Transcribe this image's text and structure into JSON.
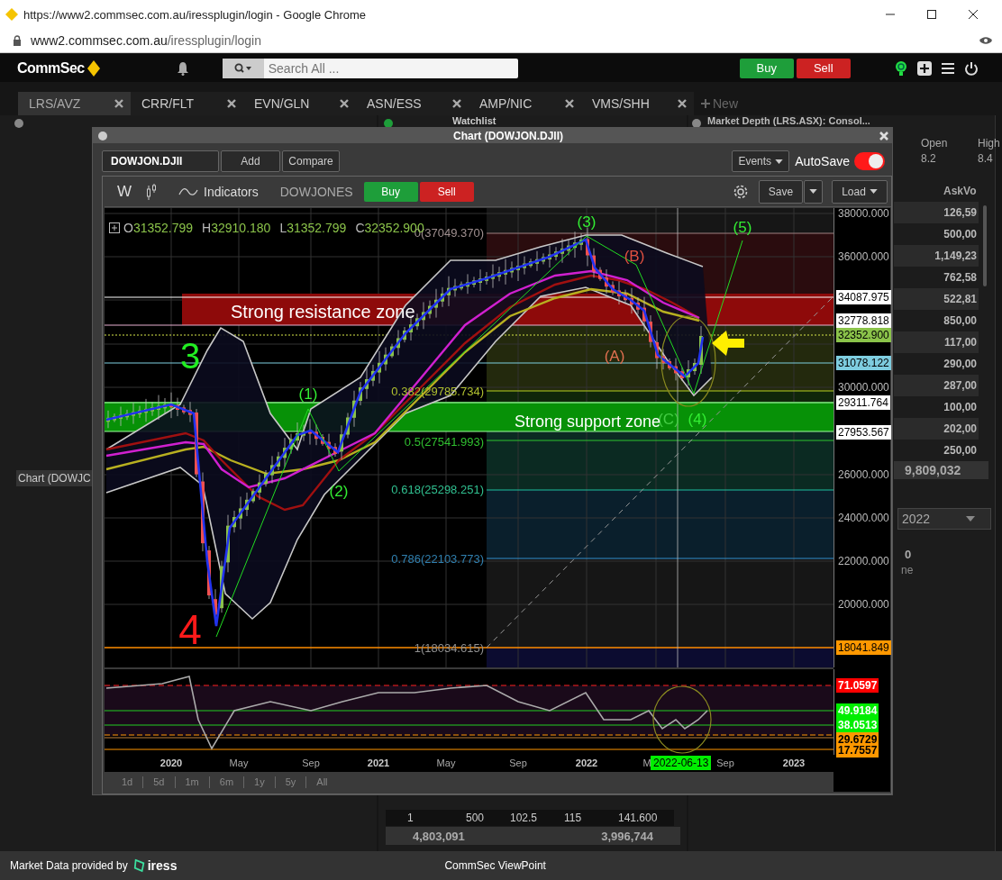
{
  "browser": {
    "title": "https://www2.commsec.com.au/iressplugin/login - Google Chrome",
    "address_host": "www2.commsec.com.au",
    "address_path": "/iressplugin/login"
  },
  "app_header": {
    "logo": "CommSec",
    "search": {
      "placeholder": "Search All ..."
    },
    "buttons": [
      {
        "label": "Buy",
        "kind": "buy"
      },
      {
        "label": "Sell",
        "kind": "sell"
      }
    ]
  },
  "tabs": [
    {
      "label": "LRS/AVZ",
      "selected": true
    },
    {
      "label": "CRR/FLT",
      "selected": false
    },
    {
      "label": "EVN/GLN",
      "selected": false
    },
    {
      "label": "ASN/ESS",
      "selected": false
    },
    {
      "label": "AMP/NIC",
      "selected": false
    },
    {
      "label": "VMS/SHH",
      "selected": false
    }
  ],
  "new_tab": "New",
  "left_panel": {
    "label": "Chart (DOWJC"
  },
  "watchlist": {
    "title": "Watchlist",
    "row": [
      "1",
      "500",
      "102.5",
      "115",
      "141.600"
    ],
    "totals": [
      "4,803,091",
      "3,996,744"
    ]
  },
  "market_depth": {
    "title": "Market Depth (LRS.ASX): Consol...",
    "stats": [
      {
        "label": "Open",
        "value": "8.2"
      },
      {
        "label": "High",
        "value": "8.4"
      }
    ],
    "column_header": "AskVo",
    "rows": [
      "126,59",
      "500,00",
      "1,149,23",
      "762,58",
      "522,81",
      "850,00",
      "117,00",
      "290,00",
      "287,00",
      "100,00",
      "202,00",
      "250,00"
    ],
    "total": "9,809,032",
    "date_field": "2022",
    "count": "0",
    "label_fragment": "ne"
  },
  "footer": {
    "provider_text": "Market Data provided by",
    "provider_logo": "iress",
    "title": "CommSec ViewPoint"
  },
  "chart_window": {
    "title": "Chart (DOWJON.DJII)",
    "symbol": "DOWJON.DJII",
    "buttons": [
      "Add",
      "Compare"
    ],
    "events": "Events",
    "autosave": {
      "label": "AutoSave",
      "on": true
    },
    "toolbar": {
      "period": "W",
      "indicators": "Indicators",
      "instrument": "DOWJONES",
      "buy": "Buy",
      "sell": "Sell",
      "save": "Save",
      "load": "Load"
    },
    "ohlc": [
      {
        "label": "O",
        "value": "31352.799"
      },
      {
        "label": "H",
        "value": "32910.180"
      },
      {
        "label": "L",
        "value": "31352.799"
      },
      {
        "label": "C",
        "value": "32352.900"
      }
    ],
    "zones": [
      "Strong resistance zone",
      "Strong support zone"
    ],
    "annotations": [
      {
        "text": "(3)",
        "color": "#33ee33"
      },
      {
        "text": "(5)",
        "color": "#33ee33"
      },
      {
        "text": "(B)",
        "color": "#e05040"
      },
      {
        "text": "(A)",
        "color": "#e07050"
      },
      {
        "text": "(1)",
        "color": "#33ee33"
      },
      {
        "text": "(2)",
        "color": "#33ee33"
      },
      {
        "text": "(C)",
        "color": "#44cc44"
      },
      {
        "text": "(4)",
        "color": "#33ee33"
      },
      {
        "text": "3",
        "color": "#22ee22"
      },
      {
        "text": "4",
        "color": "#ff1a1a"
      }
    ],
    "fib_levels": [
      {
        "text": "0(37049.370)",
        "color": "#a09090"
      },
      {
        "text": "0.382(29785.734)",
        "color": "#b0c030"
      },
      {
        "text": "0.5(27541.993)",
        "color": "#30c030"
      },
      {
        "text": "0.618(25298.251)",
        "color": "#30c090"
      },
      {
        "text": "0.786(22103.773)",
        "color": "#3080b0"
      },
      {
        "text": "1(18034.615)",
        "color": "#909090"
      }
    ],
    "price_axis": [
      {
        "label": "38000.000",
        "kind": "tick"
      },
      {
        "label": "36000.000",
        "kind": "tick"
      },
      {
        "label": "34087.975",
        "kind": "tag",
        "color": "#ffffff"
      },
      {
        "label": "32778.818",
        "kind": "tag",
        "color": "#ffffff"
      },
      {
        "label": "32352.900",
        "kind": "tag",
        "color": "#8bc34a"
      },
      {
        "label": "31078.122",
        "kind": "tag",
        "color": "#7ecde0"
      },
      {
        "label": "30000.000",
        "kind": "tick"
      },
      {
        "label": "29311.764",
        "kind": "tag",
        "color": "#ffffff"
      },
      {
        "label": "27953.567",
        "kind": "tag",
        "color": "#ffffff"
      },
      {
        "label": "26000.000",
        "kind": "tick"
      },
      {
        "label": "24000.000",
        "kind": "tick"
      },
      {
        "label": "22000.000",
        "kind": "tick"
      },
      {
        "label": "20000.000",
        "kind": "tick"
      },
      {
        "label": "18041.849",
        "kind": "tag",
        "color": "#ff9800"
      }
    ],
    "rsi_axis": [
      {
        "label": "71.0597",
        "kind": "tag",
        "color": "#ff0000"
      },
      {
        "label": "49.9184",
        "kind": "tag",
        "color": "#00ee00"
      },
      {
        "label": "38.0513",
        "kind": "tag",
        "color": "#00ee00"
      },
      {
        "label": "29.6729",
        "kind": "tag",
        "color": "#ff9800"
      },
      {
        "label": "17.7557",
        "kind": "tag",
        "color": "#ff9800"
      }
    ],
    "time_axis": [
      {
        "label": "2020",
        "kind": "year"
      },
      {
        "label": "May",
        "kind": "month"
      },
      {
        "label": "Sep",
        "kind": "month"
      },
      {
        "label": "2021",
        "kind": "year"
      },
      {
        "label": "May",
        "kind": "month"
      },
      {
        "label": "Sep",
        "kind": "month"
      },
      {
        "label": "2022",
        "kind": "year"
      },
      {
        "label": "M",
        "kind": "month"
      },
      {
        "label": "Sep",
        "kind": "month"
      },
      {
        "label": "2023",
        "kind": "year"
      }
    ],
    "cursor_date": "2022-06-13",
    "ranges": [
      "1d",
      "5d",
      "1m",
      "6m",
      "1y",
      "5y",
      "All"
    ]
  }
}
